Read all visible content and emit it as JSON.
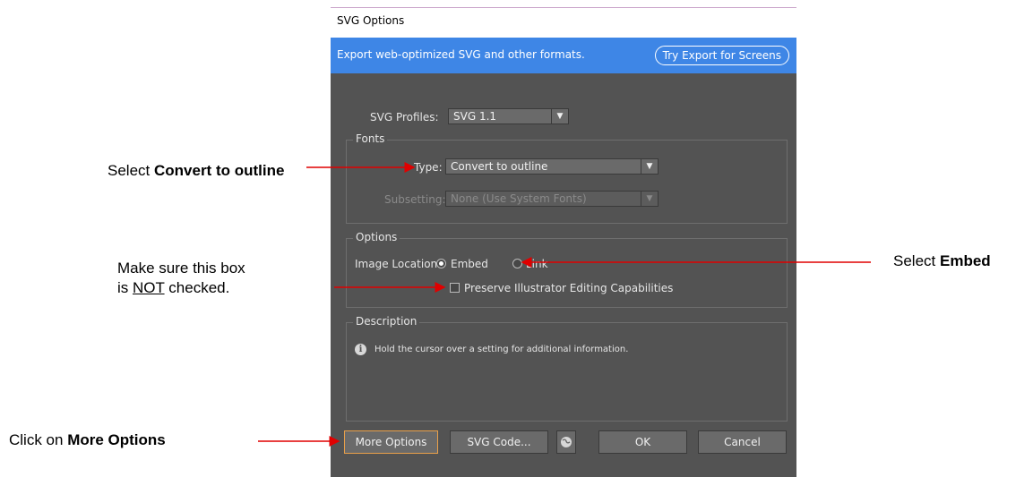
{
  "dialog": {
    "title": "SVG Options",
    "banner_text": "Export web-optimized SVG and other formats.",
    "banner_button": "Try Export for Screens",
    "svg_profiles": {
      "label": "SVG Profiles:",
      "value": "SVG 1.1"
    },
    "fonts": {
      "group_title": "Fonts",
      "type_label": "Type:",
      "type_value": "Convert to outline",
      "subsetting_label": "Subsetting:",
      "subsetting_value": "None (Use System Fonts)"
    },
    "options": {
      "group_title": "Options",
      "image_location_label": "Image Location:",
      "embed_label": "Embed",
      "link_label": "Link",
      "selected": "Embed",
      "preserve_label": "Preserve Illustrator Editing Capabilities",
      "preserve_checked": false
    },
    "description": {
      "group_title": "Description",
      "text": "Hold the cursor over a setting for additional information."
    },
    "buttons": {
      "more_options": "More Options",
      "svg_code": "SVG Code...",
      "ok": "OK",
      "cancel": "Cancel"
    }
  },
  "annotations": {
    "convert": {
      "prefix": "Select ",
      "bold": "Convert to outline"
    },
    "checkbox": {
      "line1": "Make sure this box",
      "line2_prefix": "is ",
      "line2_underline": "NOT",
      "line2_suffix": " checked."
    },
    "embed": {
      "prefix": "Select ",
      "bold": "Embed"
    },
    "more": {
      "prefix": "Click on ",
      "bold": "More Options"
    }
  },
  "colors": {
    "arrow": "#e00000",
    "banner": "#3e86e6",
    "dialog_bg": "#535353",
    "focus": "#e8a04a"
  }
}
